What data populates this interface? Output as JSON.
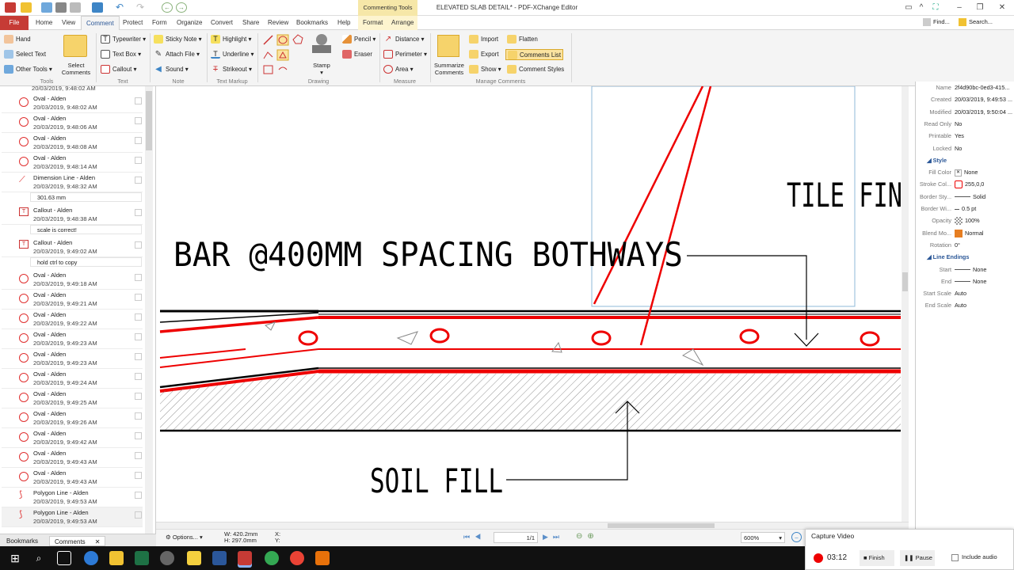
{
  "window": {
    "title": "ELEVATED SLAB DETAIL* - PDF-XChange Editor",
    "context_tab_group": "Commenting Tools",
    "find_label": "Find...",
    "search_label": "Search..."
  },
  "tabs": [
    "File",
    "Home",
    "View",
    "Comment",
    "Protect",
    "Form",
    "Organize",
    "Convert",
    "Share",
    "Review",
    "Bookmarks",
    "Help",
    "Format",
    "Arrange"
  ],
  "ribbon": {
    "tools": {
      "items": [
        "Hand",
        "Select Text",
        "Other Tools"
      ],
      "label": "Tools"
    },
    "select_comments": "Select Comments",
    "text": {
      "items": [
        "Typewriter",
        "Text Box",
        "Callout"
      ],
      "label": "Text"
    },
    "note": {
      "items": [
        "Sticky Note",
        "Attach File",
        "Sound"
      ],
      "label": "Note"
    },
    "markup": {
      "items": [
        "Highlight",
        "Underline",
        "Strikeout"
      ],
      "label": "Text Markup"
    },
    "drawing": {
      "stamp": "Stamp",
      "items": [
        "Pencil",
        "Eraser"
      ],
      "label": "Drawing"
    },
    "measure": {
      "items": [
        "Distance",
        "Perimeter",
        "Area"
      ],
      "label": "Measure"
    },
    "manage": {
      "summarize": "Summarize Comments",
      "items": [
        "Import",
        "Export",
        "Show"
      ],
      "items2": [
        "Flatten",
        "Comments List",
        "Comment Styles"
      ],
      "label": "Manage Comments"
    }
  },
  "comments": [
    {
      "type": "oval",
      "title": "Oval - Alden",
      "time": "20/03/2019, 9:48:02 AM"
    },
    {
      "type": "oval",
      "title": "Oval - Alden",
      "time": "20/03/2019, 9:48:06 AM"
    },
    {
      "type": "oval",
      "title": "Oval - Alden",
      "time": "20/03/2019, 9:48:08 AM"
    },
    {
      "type": "oval",
      "title": "Oval - Alden",
      "time": "20/03/2019, 9:48:14 AM"
    },
    {
      "type": "dim",
      "title": "Dimension Line - Alden",
      "time": "20/03/2019, 9:48:32 AM",
      "note": "301.63 mm"
    },
    {
      "type": "callout",
      "title": "Callout - Alden",
      "time": "20/03/2019, 9:48:38 AM",
      "note": "scale is correct!"
    },
    {
      "type": "callout",
      "title": "Callout - Alden",
      "time": "20/03/2019, 9:49:02 AM",
      "note": "hold ctrl to copy"
    },
    {
      "type": "oval",
      "title": "Oval - Alden",
      "time": "20/03/2019, 9:49:18 AM"
    },
    {
      "type": "oval",
      "title": "Oval - Alden",
      "time": "20/03/2019, 9:49:21 AM"
    },
    {
      "type": "oval",
      "title": "Oval - Alden",
      "time": "20/03/2019, 9:49:22 AM"
    },
    {
      "type": "oval",
      "title": "Oval - Alden",
      "time": "20/03/2019, 9:49:23 AM"
    },
    {
      "type": "oval",
      "title": "Oval - Alden",
      "time": "20/03/2019, 9:49:23 AM"
    },
    {
      "type": "oval",
      "title": "Oval - Alden",
      "time": "20/03/2019, 9:49:24 AM"
    },
    {
      "type": "oval",
      "title": "Oval - Alden",
      "time": "20/03/2019, 9:49:25 AM"
    },
    {
      "type": "oval",
      "title": "Oval - Alden",
      "time": "20/03/2019, 9:49:26 AM"
    },
    {
      "type": "oval",
      "title": "Oval - Alden",
      "time": "20/03/2019, 9:49:42 AM"
    },
    {
      "type": "oval",
      "title": "Oval - Alden",
      "time": "20/03/2019, 9:49:43 AM"
    },
    {
      "type": "oval",
      "title": "Oval - Alden",
      "time": "20/03/2019, 9:49:43 AM"
    },
    {
      "type": "poly",
      "title": "Polygon Line - Alden",
      "time": "20/03/2019, 9:49:53 AM"
    },
    {
      "type": "poly",
      "title": "Polygon Line - Alden",
      "time": "20/03/2019, 9:49:53 AM"
    }
  ],
  "panel_tabs": [
    "Bookmarks",
    "Comments"
  ],
  "drawing_text": {
    "bar": "BAR @400MM SPACING BOTHWAYS",
    "soil": "SOIL FILL",
    "tile": "TILE FIN"
  },
  "status": {
    "options": "Options...",
    "w": "W: 420.2mm",
    "h": "H: 297.0mm",
    "x": "X:",
    "y": "Y:",
    "page": "1/1",
    "zoom": "600%"
  },
  "properties": {
    "rows": [
      {
        "k": "Name",
        "v": "2f4d90bc-0ed3-415..."
      },
      {
        "k": "Created",
        "v": "20/03/2019, 9:49:53 ..."
      },
      {
        "k": "Modified",
        "v": "20/03/2019, 9:50:04 ..."
      },
      {
        "k": "Read Only",
        "v": "No"
      },
      {
        "k": "Printable",
        "v": "Yes"
      },
      {
        "k": "Locked",
        "v": "No"
      }
    ],
    "style_label": "Style",
    "style": [
      {
        "k": "Fill Color",
        "v": "None"
      },
      {
        "k": "Stroke Col...",
        "v": "255,0,0"
      },
      {
        "k": "Border Sty...",
        "v": "Solid"
      },
      {
        "k": "Border Wi...",
        "v": "0.5 pt"
      },
      {
        "k": "Opacity",
        "v": "100%"
      },
      {
        "k": "Blend Mo...",
        "v": "Normal"
      },
      {
        "k": "Rotation",
        "v": "0°"
      }
    ],
    "line_label": "Line Endings",
    "line": [
      {
        "k": "Start",
        "v": "None"
      },
      {
        "k": "End",
        "v": "None"
      },
      {
        "k": "Start Scale",
        "v": "Auto"
      },
      {
        "k": "End Scale",
        "v": "Auto"
      }
    ]
  },
  "capture": {
    "title": "Capture Video",
    "time": "03:12",
    "finish": "Finish",
    "pause": "Pause",
    "audio": "Include audio"
  }
}
